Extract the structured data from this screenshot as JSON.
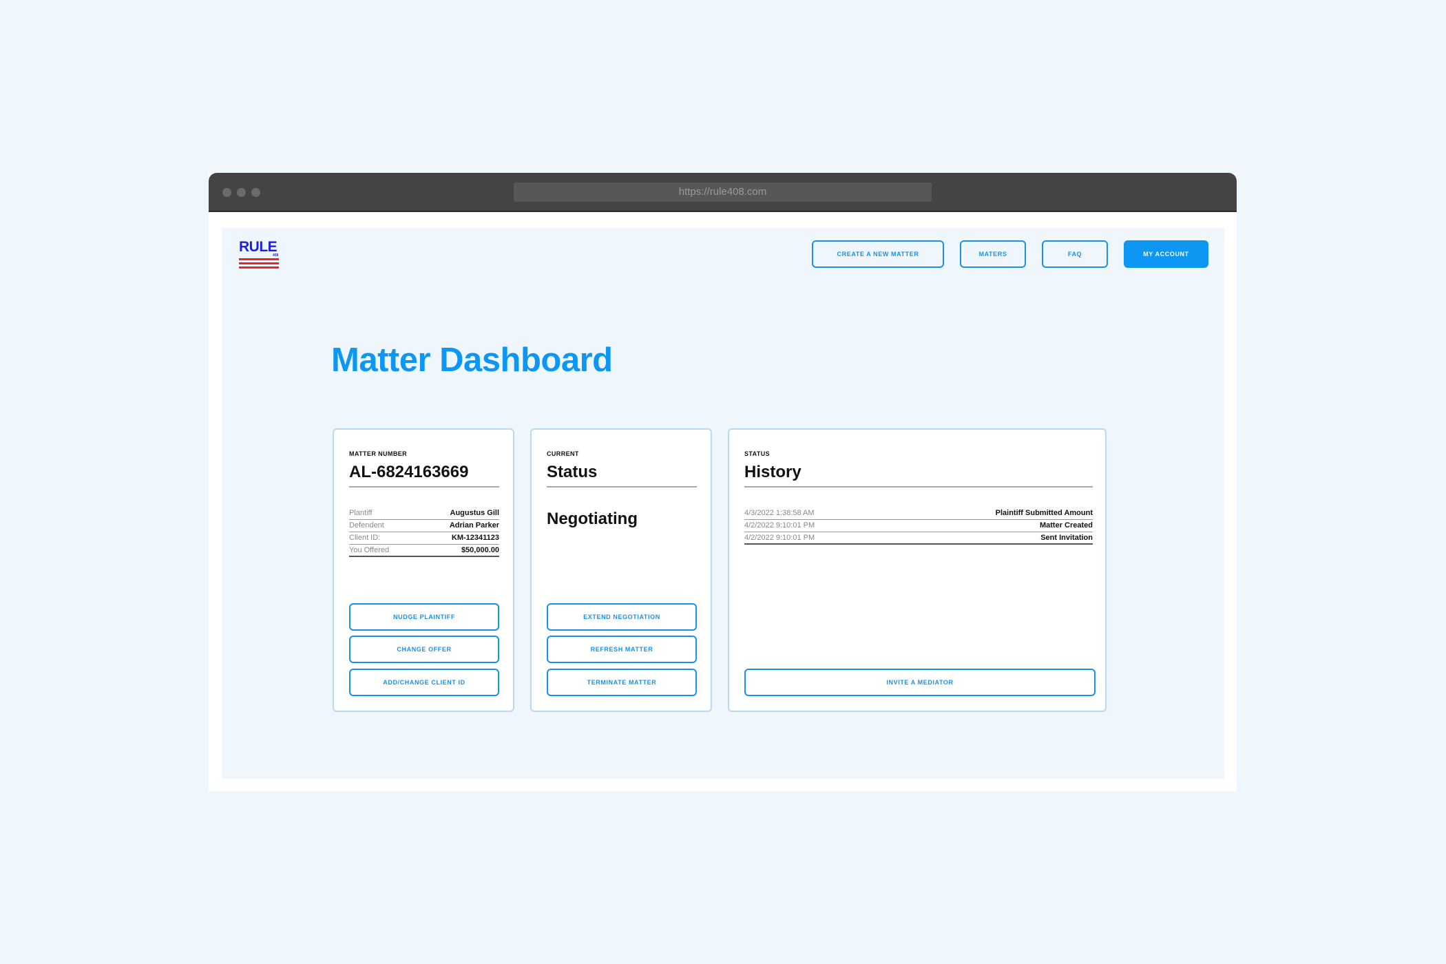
{
  "browser": {
    "url": "https://rule408.com"
  },
  "logo": {
    "word": "RULE",
    "sub": "408"
  },
  "nav": {
    "create": "CREATE A NEW MATTER",
    "maters": "MATERS",
    "faq": "FAQ",
    "account": "MY ACCOUNT"
  },
  "page": {
    "title": "Matter Dashboard"
  },
  "matter": {
    "label": "MATTER NUMBER",
    "number": "AL-6824163669",
    "rows": [
      {
        "key": "Plantiff",
        "value": "Augustus Gill"
      },
      {
        "key": "Defendent",
        "value": "Adrian Parker"
      },
      {
        "key": "Client ID:",
        "value": "KM-12341123"
      },
      {
        "key": "You Offered",
        "value": "$50,000.00"
      }
    ],
    "buttons": [
      "NUDGE PLAINTIFF",
      "CHANGE OFFER",
      "ADD/CHANGE CLIENT ID"
    ]
  },
  "status": {
    "label": "CURRENT",
    "heading": "Status",
    "value": "Negotiating",
    "buttons": [
      "EXTEND NEGOTIATION",
      "REFRESH MATTER",
      "TERMINATE MATTER"
    ]
  },
  "history": {
    "label": "STATUS",
    "heading": "History",
    "rows": [
      {
        "time": "4/3/2022 1:38:58 AM",
        "event": "Plaintiff Submitted Amount"
      },
      {
        "time": "4/2/2022 9:10:01 PM",
        "event": "Matter Created"
      },
      {
        "time": "4/2/2022 9:10:01 PM",
        "event": "Sent Invitation"
      }
    ],
    "button": "INVITE A MEDIATOR"
  },
  "colors": {
    "accent": "#0d96f2",
    "outline": "#1a90e8",
    "card_border": "#b7daf2",
    "logo_blue": "#1f1fd9",
    "logo_red": "#e8262a"
  }
}
